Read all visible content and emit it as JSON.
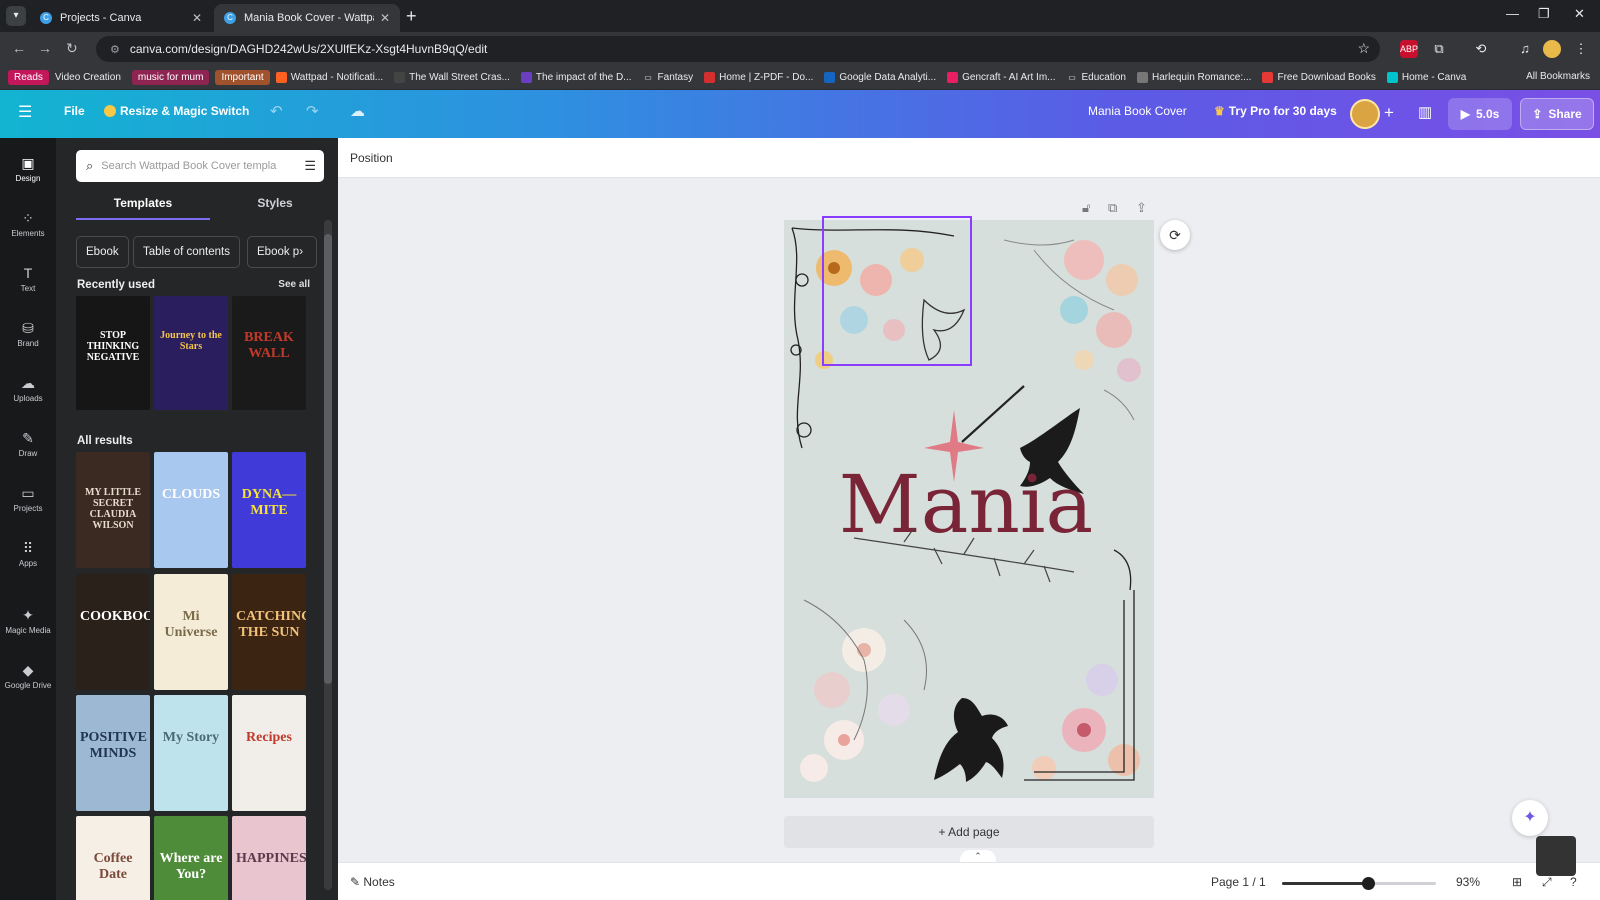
{
  "browser": {
    "tabs": [
      {
        "title": "Projects - Canva",
        "active": false
      },
      {
        "title": "Mania Book Cover - Wattpad B",
        "active": true
      }
    ],
    "url": "canva.com/design/DAGHD242wUs/2XUlfEKz-Xsgt4HuvnB9qQ/edit",
    "bookmarks": [
      {
        "label": "Reads",
        "icon": "pill",
        "color": "#c2185b"
      },
      {
        "label": "Video Creation",
        "icon": "none",
        "color": ""
      },
      {
        "label": "music for mum",
        "icon": "pill",
        "color": "#8e2452"
      },
      {
        "label": "Important",
        "icon": "pill",
        "color": "#a0522d"
      },
      {
        "label": "Wattpad - Notificati...",
        "icon": "wattpad",
        "color": "#ff6122"
      },
      {
        "label": "The Wall Street Cras...",
        "icon": "h-logo",
        "color": "#444444"
      },
      {
        "label": "The impact of the D...",
        "icon": "i-logo",
        "color": "#6a3fbf"
      },
      {
        "label": "Fantasy",
        "icon": "folder",
        "color": ""
      },
      {
        "label": "Home | Z-PDF - Do...",
        "icon": "zpdf",
        "color": "#d32f2f"
      },
      {
        "label": "Google Data Analyti...",
        "icon": "c-logo",
        "color": "#1565c0"
      },
      {
        "label": "Gencraft - AI Art Im...",
        "icon": "gencraft",
        "color": "#e91e63"
      },
      {
        "label": "Education",
        "icon": "folder",
        "color": ""
      },
      {
        "label": "Harlequin Romance:...",
        "icon": "book",
        "color": "#777777"
      },
      {
        "label": "Free Download Books",
        "icon": "heart",
        "color": "#e53935"
      },
      {
        "label": "Home - Canva",
        "icon": "canva",
        "color": "#00c4cc"
      }
    ],
    "all_bookmarks": "All Bookmarks"
  },
  "topbar": {
    "file": "File",
    "resize": "Resize & Magic Switch",
    "title": "Mania Book Cover",
    "try_pro": "Try Pro for 30 days",
    "timer": "5.0s",
    "share": "Share"
  },
  "rail": [
    {
      "label": "Design",
      "icon": "design-icon",
      "glyph": "▣"
    },
    {
      "label": "Elements",
      "icon": "elements-icon",
      "glyph": "⁘"
    },
    {
      "label": "Text",
      "icon": "text-icon",
      "glyph": "T"
    },
    {
      "label": "Brand",
      "icon": "brand-icon",
      "glyph": "⛁"
    },
    {
      "label": "Uploads",
      "icon": "uploads-icon",
      "glyph": "☁"
    },
    {
      "label": "Draw",
      "icon": "draw-icon",
      "glyph": "✎"
    },
    {
      "label": "Projects",
      "icon": "projects-icon",
      "glyph": "▭"
    },
    {
      "label": "Apps",
      "icon": "apps-icon",
      "glyph": "⠿"
    },
    {
      "label": "Magic Media",
      "icon": "magic-media-icon",
      "glyph": "✦"
    },
    {
      "label": "Google Drive",
      "icon": "google-drive-icon",
      "glyph": "◆"
    }
  ],
  "panel": {
    "search_placeholder": "Search Wattpad Book Cover templa",
    "tabs": [
      "Templates",
      "Styles"
    ],
    "chips": [
      "Ebook",
      "Table of contents",
      "Ebook p"
    ],
    "recently_used": "Recently used",
    "see_all": "See all",
    "all_results": "All results",
    "recent_thumbs": [
      {
        "text": "STOP THINKING NEGATIVE",
        "bg": "#161616",
        "fg": "#ffffff"
      },
      {
        "text": "Journey to the Stars",
        "bg": "#2b1e5e",
        "fg": "#f5c54a"
      },
      {
        "text": "BREAK WALL",
        "bg": "#1a1a1a",
        "fg": "#c0392b"
      }
    ],
    "result_thumbs": [
      {
        "text": "MY LITTLE SECRET CLAUDIA WILSON",
        "bg": "#3a2a22",
        "fg": "#e8dccf"
      },
      {
        "text": "CLOUDS",
        "bg": "#a9c8ef",
        "fg": "#ffffff"
      },
      {
        "text": "DYNA—MITE",
        "bg": "#3f3ad8",
        "fg": "#f6e23a"
      },
      {
        "text": "COOKBOOK",
        "bg": "#2a211b",
        "fg": "#ffffff"
      },
      {
        "text": "Mi Universe",
        "bg": "#f4ecd7",
        "fg": "#7a6a4a"
      },
      {
        "text": "CATCHING THE SUN",
        "bg": "#3b2412",
        "fg": "#f2c27b"
      },
      {
        "text": "POSITIVE MINDS",
        "bg": "#9db8d2",
        "fg": "#1f3550"
      },
      {
        "text": "My Story",
        "bg": "#bfe3ec",
        "fg": "#4a6a7a"
      },
      {
        "text": "Recipes",
        "bg": "#f1eee9",
        "fg": "#c0392b"
      },
      {
        "text": "Coffee Date",
        "bg": "#f6efe6",
        "fg": "#7a4a3a"
      },
      {
        "text": "Where are You?",
        "bg": "#4f8c3a",
        "fg": "#ffffff"
      },
      {
        "text": "HAPPINESS",
        "bg": "#e9c5cf",
        "fg": "#5a3a4a"
      }
    ]
  },
  "editor": {
    "position": "Position",
    "cover_title": "Mania",
    "add_page": "+ Add page",
    "notes": "Notes",
    "page_indicator": "Page 1 / 1",
    "zoom_label": "93%",
    "zoom_fraction": 0.56
  }
}
